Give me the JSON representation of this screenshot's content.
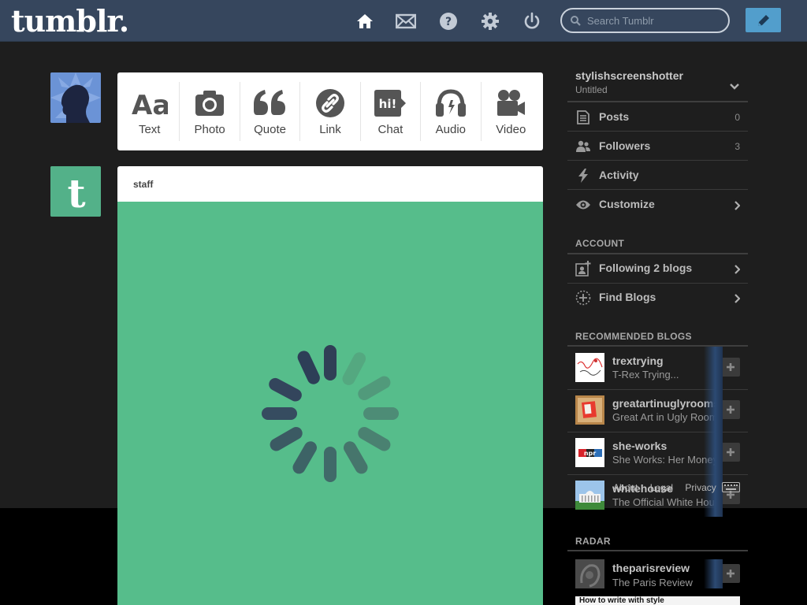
{
  "header": {
    "logo": "tumblr.",
    "search_placeholder": "Search Tumblr"
  },
  "post_types": [
    {
      "label": "Text"
    },
    {
      "label": "Photo"
    },
    {
      "label": "Quote"
    },
    {
      "label": "Link"
    },
    {
      "label": "Chat",
      "badge": "hi!"
    },
    {
      "label": "Audio"
    },
    {
      "label": "Video"
    }
  ],
  "post": {
    "author": "staff"
  },
  "sidebar": {
    "blog_name": "stylishscreenshotter",
    "blog_title": "Untitled",
    "nav": [
      {
        "label": "Posts",
        "count": "0"
      },
      {
        "label": "Followers",
        "count": "3"
      },
      {
        "label": "Activity"
      },
      {
        "label": "Customize"
      }
    ],
    "account_heading": "ACCOUNT",
    "account_items": [
      {
        "label": "Following 2 blogs"
      },
      {
        "label": "Find Blogs"
      }
    ],
    "recommended_heading": "RECOMMENDED BLOGS",
    "recommended": [
      {
        "name": "trextrying",
        "desc": "T-Rex Trying..."
      },
      {
        "name": "greatartinuglyrooms",
        "desc": "Great Art in Ugly Rooms"
      },
      {
        "name": "she-works",
        "desc": "She Works: Her Money",
        "thumb_text": "npr"
      },
      {
        "name": "whitehouse",
        "desc": "The Official White House"
      }
    ],
    "footer_links": [
      "About",
      "Legal",
      "Privacy"
    ],
    "radar_heading": "RADAR",
    "radar": [
      {
        "name": "theparisreview",
        "desc": "The Paris Review"
      }
    ],
    "radar_post_title": "How to write with style"
  },
  "colors": {
    "header_bg": "#36465d",
    "page_bg": "#1e1e1e",
    "accent": "#529ecc",
    "post_green": "#56bd8b"
  }
}
